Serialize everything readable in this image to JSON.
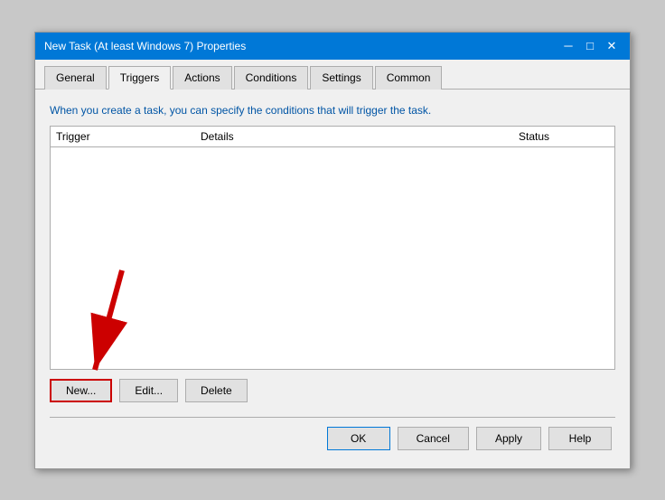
{
  "window": {
    "title": "New Task (At least Windows 7) Properties",
    "close_label": "✕"
  },
  "tabs": [
    {
      "id": "general",
      "label": "General"
    },
    {
      "id": "triggers",
      "label": "Triggers",
      "active": true
    },
    {
      "id": "actions",
      "label": "Actions"
    },
    {
      "id": "conditions",
      "label": "Conditions"
    },
    {
      "id": "settings",
      "label": "Settings"
    },
    {
      "id": "common",
      "label": "Common"
    }
  ],
  "info_text": "When you create a task, you can specify the conditions that will trigger the task.",
  "table": {
    "columns": [
      {
        "id": "trigger",
        "label": "Trigger"
      },
      {
        "id": "details",
        "label": "Details"
      },
      {
        "id": "status",
        "label": "Status"
      }
    ]
  },
  "action_buttons": {
    "new": "New...",
    "edit": "Edit...",
    "delete": "Delete"
  },
  "dialog_buttons": {
    "ok": "OK",
    "cancel": "Cancel",
    "apply": "Apply",
    "help": "Help"
  }
}
